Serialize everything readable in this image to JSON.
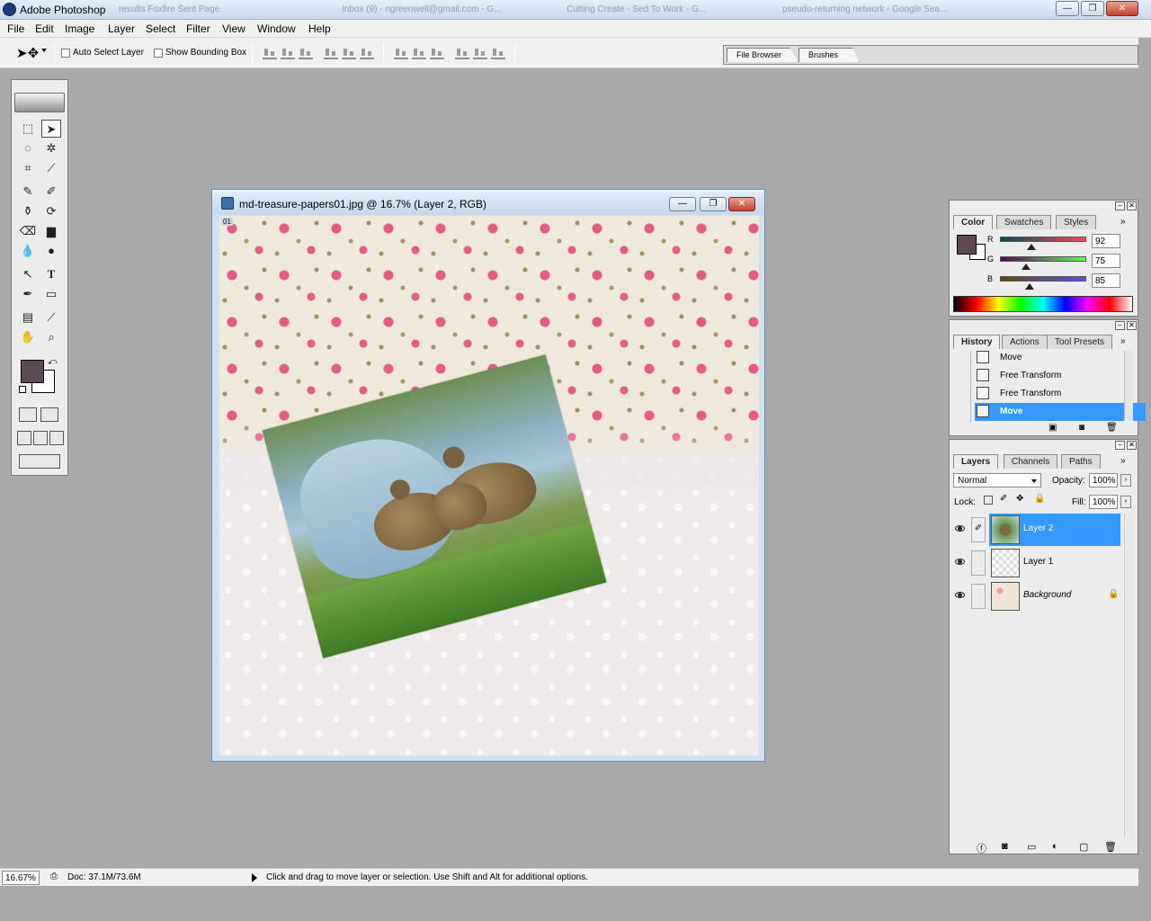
{
  "app": {
    "title": "Adobe Photoshop",
    "ghost_tabs": [
      "results Foxfire Sent Page",
      "Inbox (9) - ngreenwell@gmail.com - G...",
      "Cutting Create - Sed To Work - G...",
      "pseudo-returning network - Google Sea..."
    ],
    "window_buttons": {
      "minimize": "—",
      "restore": "❐",
      "close": "✕"
    }
  },
  "menu": [
    "File",
    "Edit",
    "Image",
    "Layer",
    "Select",
    "Filter",
    "View",
    "Window",
    "Help"
  ],
  "options_bar": {
    "auto_select_label": "Auto Select Layer",
    "show_bounding_box_label": "Show Bounding Box",
    "auto_select_checked": false,
    "show_bounding_box_checked": false,
    "palette_well_tabs": [
      "File Browser",
      "Brushes"
    ]
  },
  "toolbox": {
    "foreground_color": "#5c4b55",
    "background_color": "#ffffff"
  },
  "document": {
    "title": "md-treasure-papers01.jpg @ 16.7% (Layer 2, RGB)",
    "corner_label": "01"
  },
  "color_panel": {
    "tabs": [
      "Color",
      "Swatches",
      "Styles"
    ],
    "r_label": "R",
    "g_label": "G",
    "b_label": "B",
    "r": "92",
    "g": "75",
    "b": "85",
    "swatch": "#5c4b55"
  },
  "history_panel": {
    "tabs": [
      "History",
      "Actions",
      "Tool Presets"
    ],
    "items": [
      {
        "label": "Move"
      },
      {
        "label": "Free Transform"
      },
      {
        "label": "Free Transform"
      },
      {
        "label": "Move"
      }
    ],
    "selected_index": 3
  },
  "layers_panel": {
    "tabs": [
      "Layers",
      "Channels",
      "Paths"
    ],
    "blend_mode": "Normal",
    "opacity_label": "Opacity:",
    "opacity": "100%",
    "lock_label": "Lock:",
    "fill_label": "Fill:",
    "fill": "100%",
    "layers": [
      {
        "name": "Layer 2",
        "selected": true
      },
      {
        "name": "Layer 1",
        "selected": false
      },
      {
        "name": "Background",
        "selected": false
      }
    ]
  },
  "status_bar": {
    "zoom": "16.67%",
    "doc": "Doc: 37.1M/73.6M",
    "hint": "Click and drag to move layer or selection.  Use Shift and Alt for additional options."
  }
}
